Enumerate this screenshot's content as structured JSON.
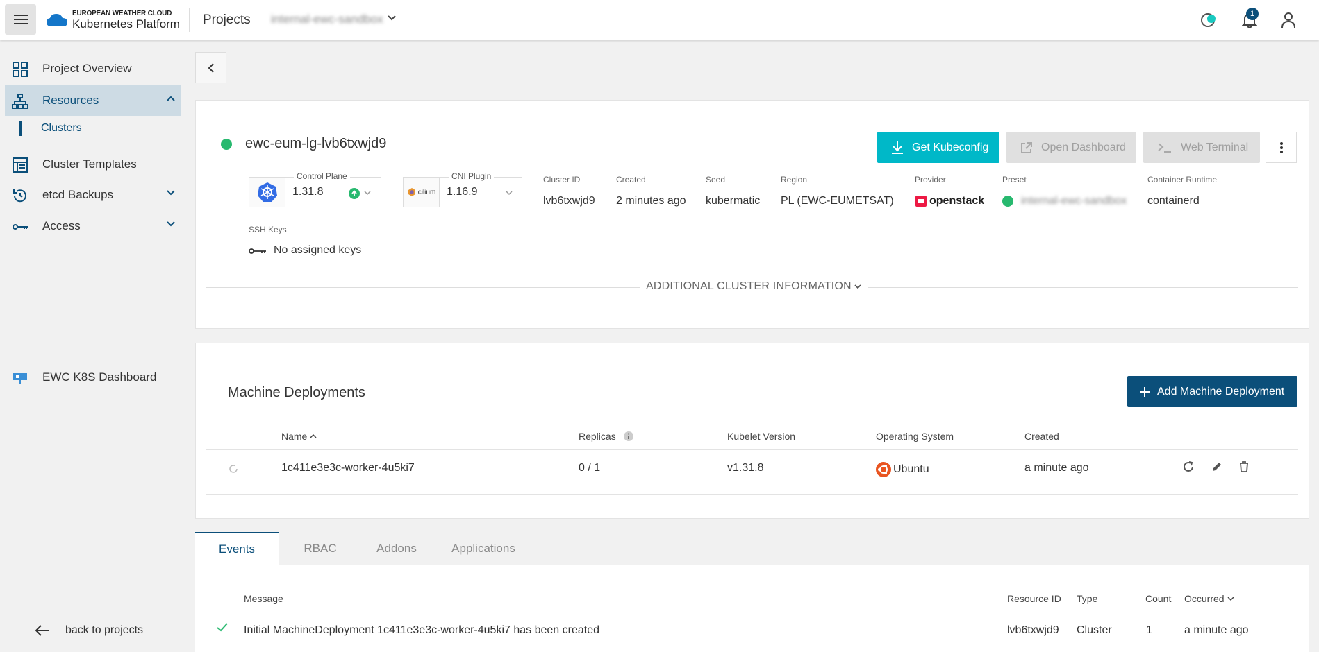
{
  "app": {
    "logo_line1": "EUROPEAN WEATHER CLOUD",
    "logo_line2": "Kubernetes Platform",
    "projects_label": "Projects",
    "project_name": "internal-ewc-sandbox",
    "notification_count": "1"
  },
  "sidebar": {
    "items": [
      {
        "label": "Project Overview"
      },
      {
        "label": "Resources"
      },
      {
        "label": "Cluster Templates"
      },
      {
        "label": "etcd Backups"
      },
      {
        "label": "Access"
      }
    ],
    "sub_item": "Clusters",
    "dashboard": "EWC K8S Dashboard",
    "back": "back to projects"
  },
  "cluster": {
    "name": "ewc-eum-lg-lvb6txwjd9",
    "status_color": "#28b96f",
    "buttons": {
      "kubeconfig": "Get Kubeconfig",
      "dashboard": "Open Dashboard",
      "terminal": "Web Terminal"
    },
    "control_plane": {
      "legend": "Control Plane",
      "value": "1.31.8"
    },
    "cni": {
      "legend": "CNI Plugin",
      "value": "1.16.9",
      "logo": "cilium"
    },
    "meta": {
      "id_label": "Cluster ID",
      "id": "lvb6txwjd9",
      "created_label": "Created",
      "created": "2 minutes ago",
      "seed_label": "Seed",
      "seed": "kubermatic",
      "region_label": "Region",
      "region": "PL (EWC-EUMETSAT)",
      "provider_label": "Provider",
      "provider": "openstack",
      "preset_label": "Preset",
      "preset": "internal-ewc-sandbox",
      "runtime_label": "Container Runtime",
      "runtime": "containerd"
    },
    "ssh_label": "SSH Keys",
    "ssh_value": "No assigned keys",
    "additional": "ADDITIONAL CLUSTER INFORMATION"
  },
  "machine_deployments": {
    "title": "Machine Deployments",
    "add_button": "Add Machine Deployment",
    "columns": {
      "name": "Name",
      "replicas": "Replicas",
      "kubelet": "Kubelet Version",
      "os": "Operating System",
      "created": "Created"
    },
    "rows": [
      {
        "name": "1c411e3e3c-worker-4u5ki7",
        "replicas": "0 / 1",
        "kubelet": "v1.31.8",
        "os": "Ubuntu",
        "created": "a minute ago"
      }
    ]
  },
  "tabs": [
    "Events",
    "RBAC",
    "Addons",
    "Applications"
  ],
  "events": {
    "columns": {
      "message": "Message",
      "resource": "Resource ID",
      "type": "Type",
      "count": "Count",
      "occurred": "Occurred"
    },
    "rows": [
      {
        "message": "Initial MachineDeployment 1c411e3e3c-worker-4u5ki7 has been created",
        "resource": "lvb6txwjd9",
        "type": "Cluster",
        "count": "1",
        "occurred": "a minute ago"
      }
    ]
  },
  "colors": {
    "accent": "#0b4f7a",
    "primary_button": "#00b8c8",
    "success": "#28b96f"
  }
}
